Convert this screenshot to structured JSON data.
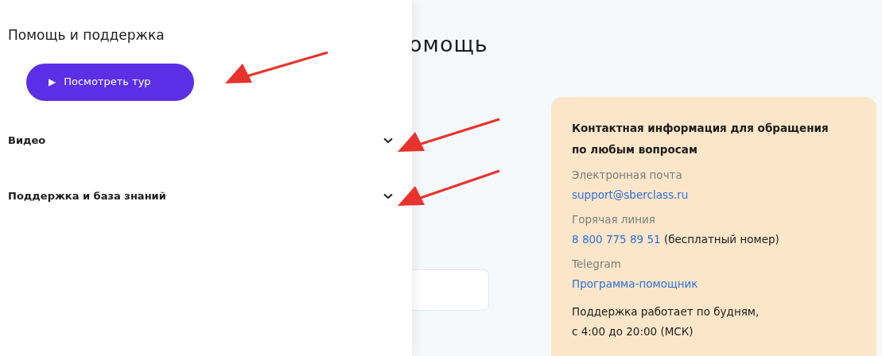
{
  "panel": {
    "title": "Помощь и поддержка",
    "tour_button": {
      "icon": "▶",
      "label": "Посмотреть тур"
    },
    "sections": [
      {
        "label": "Видео",
        "expanded": false
      },
      {
        "label": "Поддержка и база знаний",
        "expanded": false
      }
    ]
  },
  "page": {
    "heading": "омощь",
    "contact_card": {
      "title": "Контактная информация для обращения по любым вопросам",
      "entries": [
        {
          "label": "Электронная почта",
          "link": "support@sberclass.ru"
        },
        {
          "label": "Горячая линия",
          "link": "8 800 775 89 51",
          "note": " (бесплатный номер)"
        },
        {
          "label": "Telegram",
          "link": "Программа-помощник"
        }
      ],
      "hours": [
        "Поддержка работает по будням,",
        "с 4:00 до 20:00 (МСК)"
      ]
    }
  }
}
